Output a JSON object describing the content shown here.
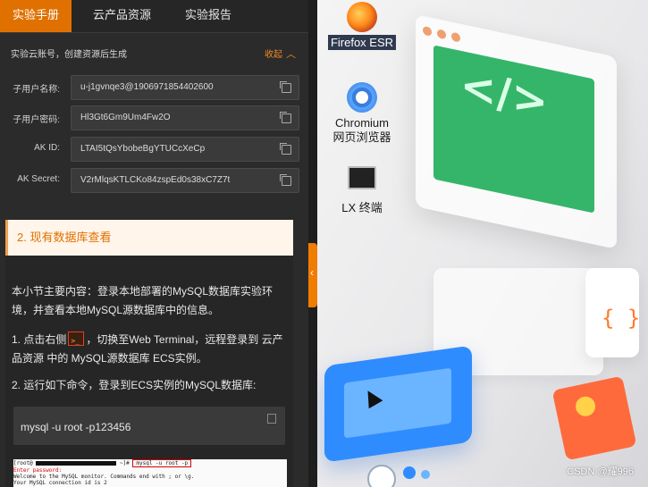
{
  "tabs": [
    "实验手册",
    "云产品资源",
    "实验报告"
  ],
  "account": {
    "header": "实验云账号，创建资源后生成",
    "collapse_label": "收起",
    "fields": [
      {
        "label": "子用户名称:",
        "value": "u-j1gvnqe3@1906971854402600"
      },
      {
        "label": "子用户密码:",
        "value": "Hl3Gt6Gm9Um4Fw2O"
      },
      {
        "label": "AK ID:",
        "value": "LTAI5tQsYbobeBgYTUCcXeCp"
      },
      {
        "label": "AK Secret:",
        "value": "V2rMlqsKTLCKo84zspEd0s38xC7Z7t"
      }
    ]
  },
  "section": {
    "title": "2. 现有数据库查看",
    "intro": "本小节主要内容：登录本地部署的MySQL数据库实验环境，并查看本地MySQL源数据库中的信息。",
    "step1_a": "1. 点击右侧",
    "step1_b": "，切换至Web Terminal，远程登录到 云产品资源 中的 MySQL源数据库 ECS实例。",
    "step2": "2. 运行如下命令，登录到ECS实例的MySQL数据库:",
    "command": "mysql -u root -p123456",
    "terminal_lines": [
      "[root@",
      "mysql -u root -p",
      "Enter password:",
      "Welcome to the MySQL monitor.  Commands end with ; or \\g.",
      "Your MySQL connection id is 2"
    ]
  },
  "desktop": {
    "icons": [
      {
        "label": "Firefox ESR",
        "icon": "firefox-icon"
      },
      {
        "label": "Chromium 网页浏览器",
        "icon": "chromium-icon"
      },
      {
        "label": "LX 终端",
        "icon": "terminal-icon"
      }
    ],
    "watermark": "CSDN @耀996"
  }
}
